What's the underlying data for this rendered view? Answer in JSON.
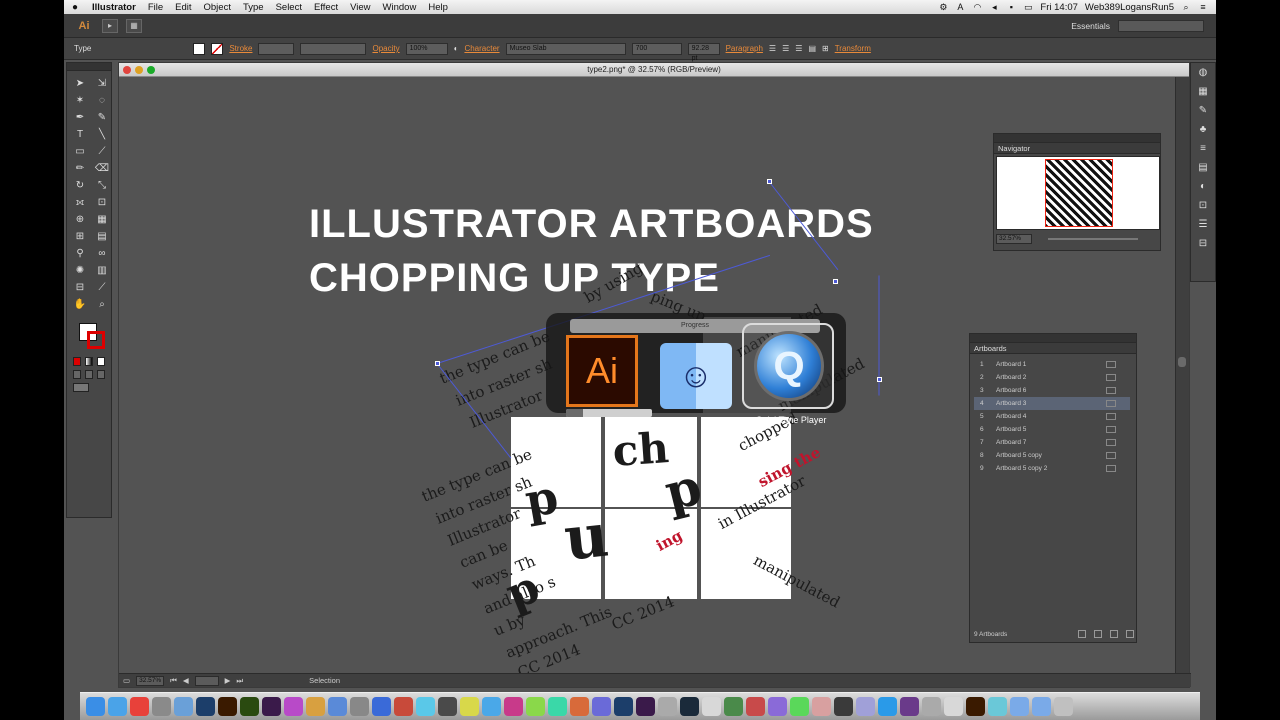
{
  "menubar": {
    "apple": "",
    "items": [
      "Illustrator",
      "File",
      "Edit",
      "Object",
      "Type",
      "Select",
      "Effect",
      "View",
      "Window",
      "Help"
    ],
    "clock": "Fri 14:07",
    "user": "Web389LogansRun5"
  },
  "appbar": {
    "logo": "Ai",
    "workspace": "Essentials"
  },
  "controlbar": {
    "tool_label": "Type",
    "stroke_label": "Stroke",
    "opacity_label": "Opacity",
    "opacity_value": "100%",
    "character_label": "Character",
    "font_value": "Museo Slab",
    "style_value": "700",
    "size_value": "92.28 pt",
    "paragraph_label": "Paragraph",
    "transform_label": "Transform"
  },
  "document": {
    "title": "type2.png* @ 32.57% (RGB/Preview)",
    "zoom": "32.57%",
    "status_tool": "Selection"
  },
  "headline": {
    "line1": "ILLUSTRATOR ARTBOARDS",
    "line2": "CHOPPING UP TYPE"
  },
  "switcher": {
    "progress_title": "Progress",
    "ai_label": "Ai",
    "ai_progress": 0.2,
    "selected_app": "QuickTime Player"
  },
  "collage_text": [
    "the type can be",
    "into raster sh",
    "Illustrator",
    "the type can be",
    "into raster sh",
    "Illustrator",
    "can be",
    "ways. Th",
    "and also s",
    "u by",
    "approach. This",
    "CC 2014",
    "manipulated",
    "manipulated",
    "chopped",
    "sing the",
    "in Illustrator",
    "manipulated",
    "CC 2014",
    "by using",
    "ing",
    "ping up",
    "p",
    "u",
    "p",
    "p",
    "ch"
  ],
  "navigator": {
    "title": "Navigator",
    "zoom": "32.57%"
  },
  "artboards_panel": {
    "title": "Artboards",
    "rows": [
      {
        "num": "1",
        "name": "Artboard 1"
      },
      {
        "num": "2",
        "name": "Artboard 2"
      },
      {
        "num": "3",
        "name": "Artboard 6"
      },
      {
        "num": "4",
        "name": "Artboard 3"
      },
      {
        "num": "5",
        "name": "Artboard 4"
      },
      {
        "num": "6",
        "name": "Artboard 5"
      },
      {
        "num": "7",
        "name": "Artboard 7"
      },
      {
        "num": "8",
        "name": "Artboard 5 copy"
      },
      {
        "num": "9",
        "name": "Artboard 5 copy 2"
      }
    ],
    "selected_index": 3,
    "footer": "9 Artboards"
  },
  "dock": {
    "icons": [
      "finder-icon",
      "safari-icon",
      "chrome-icon",
      "system-prefs-icon",
      "mail-icon",
      "photoshop-icon",
      "illustrator-icon",
      "dreamweaver-icon",
      "premiere-icon",
      "itunes-icon",
      "app-icon",
      "app-icon",
      "app-icon",
      "app-icon",
      "app-icon",
      "app-icon",
      "app-icon",
      "app-icon",
      "twitter-icon",
      "app-icon",
      "app-icon",
      "app-icon",
      "app-icon",
      "app-icon",
      "photoshop-icon",
      "premiere-icon",
      "app-icon",
      "lightroom-icon",
      "app-icon",
      "app-icon",
      "app-icon",
      "app-icon",
      "app-icon",
      "app-icon",
      "app-icon",
      "app-icon",
      "skype-icon",
      "app-icon",
      "app-icon",
      "app-icon",
      "illustrator-icon",
      "app-icon",
      "folder-icon",
      "folder-icon",
      "trash-icon"
    ],
    "colors": [
      "#3a8ee6",
      "#4aa3e8",
      "#e8413a",
      "#8a8a8a",
      "#6aa0d8",
      "#1c3e6a",
      "#3a1a00",
      "#2a4a10",
      "#3a1a4a",
      "#b84ac8",
      "#d8a040",
      "#5a8ad8",
      "#888",
      "#3a6ad8",
      "#c84a3a",
      "#5ac8e8",
      "#4a4a4a",
      "#d8d84a",
      "#4aa8e8",
      "#c83a8a",
      "#8ad84a",
      "#3ad8a8",
      "#d86a3a",
      "#6a6ad8",
      "#1c3e6a",
      "#3a1a4a",
      "#aaa",
      "#1a2a3a",
      "#d8d8d8",
      "#4a8a4a",
      "#c84a4a",
      "#8a6ad8",
      "#5ad85a",
      "#d8a0a0",
      "#3a3a3a",
      "#a0a0d8",
      "#2a9ae8",
      "#6a3a8a",
      "#aaa",
      "#d8d8d8",
      "#3a1a00",
      "#6ac8d8",
      "#7aaae8",
      "#7aaae8",
      "#c0c0c0"
    ]
  }
}
